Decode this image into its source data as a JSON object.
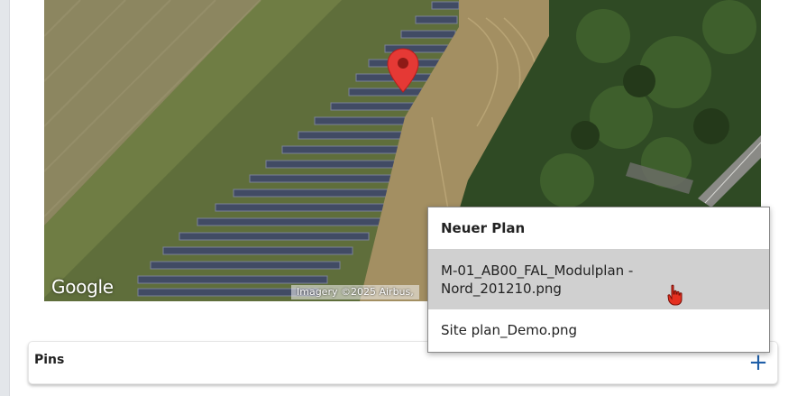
{
  "map": {
    "logo": "Google",
    "attribution": "Imagery ©2025 Airbus,",
    "pin_color": "#e53935"
  },
  "pins": {
    "title": "Pins",
    "add_icon": "plus-icon",
    "add_symbol": "+",
    "accent": "#1f5fa8"
  },
  "dropdown": {
    "header": "Neuer Plan",
    "items": [
      {
        "label_line1": "M-01_AB00_FAL_Modulplan -",
        "label_line2": "Nord_201210.png",
        "state": "hovered"
      },
      {
        "label": "Site plan_Demo.png"
      }
    ]
  }
}
